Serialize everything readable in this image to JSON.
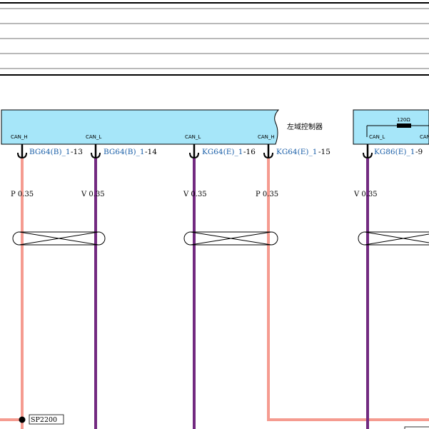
{
  "modules": [
    {
      "name": "左域控制器",
      "pins": [
        {
          "signal": "CAN_H",
          "connector": "BG64(B)_1",
          "pin": "-13",
          "wire": "P 0.35"
        },
        {
          "signal": "CAN_L",
          "connector": "BG64(B)_1",
          "pin": "-14",
          "wire": "V 0.35"
        },
        {
          "signal": "CAN_L",
          "connector": "KG64(E)_1",
          "pin": "-16",
          "wire": "V 0.35"
        },
        {
          "signal": "CAN_H",
          "connector": "KG64(E)_1",
          "pin": "-15",
          "wire": "P 0.35"
        }
      ]
    },
    {
      "name": "",
      "resistor": "120Ω",
      "pins": [
        {
          "signal": "CAN_L",
          "connector": "KG86(E)_1",
          "pin": "-9",
          "wire": "V 0.35"
        },
        {
          "signal": "CAN",
          "connector": "",
          "pin": "",
          "wire": ""
        }
      ]
    }
  ],
  "splice": "SP2200",
  "colors": {
    "module_fill": "#a6e6f9",
    "can_h_wire": "#f59b90",
    "can_l_wire": "#722a80",
    "connector_text": "#1a5fa8"
  }
}
